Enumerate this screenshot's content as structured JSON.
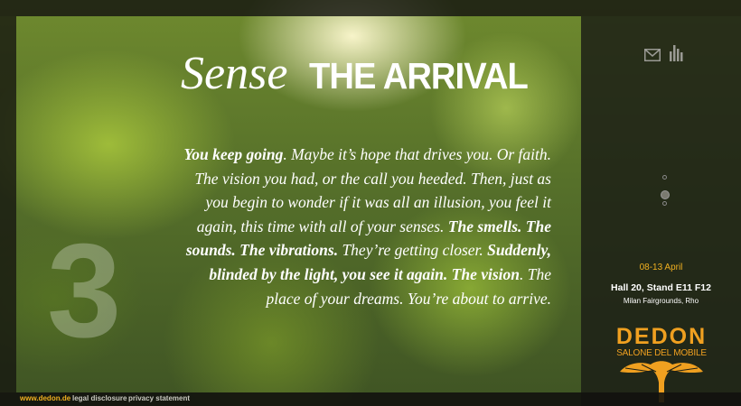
{
  "hero": {
    "title_script": "Sense",
    "title_bold": "THE ARRIVAL",
    "chapter_number": "3",
    "body_segments": [
      {
        "text": "You keep going",
        "bold": true
      },
      {
        "text": ". Maybe it’s hope that drives you. Or faith. The vision you had, or the call you heeded. Then, just as you begin to wonder if it was all an illusion, you feel it again, this time with all of your senses. ",
        "bold": false
      },
      {
        "text": "The smells. The sounds. The vibrations.",
        "bold": true
      },
      {
        "text": " They’re getting closer. ",
        "bold": false
      },
      {
        "text": "Suddenly, blinded by the light, you see it again. The vision",
        "bold": true
      },
      {
        "text": ". The place of your dreams. You’re about to arrive.",
        "bold": false
      }
    ]
  },
  "sidebar": {
    "icons": [
      "mail-icon",
      "bar-chart-icon"
    ],
    "pager": {
      "count": 3,
      "active": 1
    },
    "dates": "08-13 April",
    "hall": "Hall 20, Stand E11 F12",
    "venue": "Milan Fairgrounds, Rho",
    "logo_brand": "DEDON",
    "logo_sub": "SALONE DEL MOBILE"
  },
  "footer": {
    "site": "www.dedon.de",
    "legal": "legal disclosure",
    "privacy": "privacy statement"
  },
  "colors": {
    "accent": "#f0a020",
    "panel": "#1c1e16"
  }
}
